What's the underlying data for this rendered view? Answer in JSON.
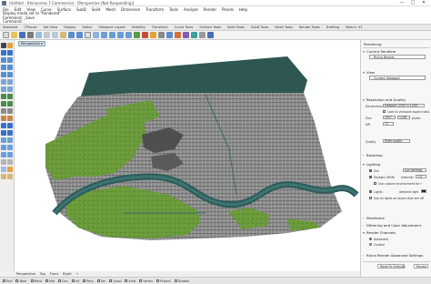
{
  "window": {
    "title": "Untitled - Rhinoceros 7 Commercial - [Perspective (Not Responding)]",
    "controls": [
      "—",
      "□",
      "✕"
    ]
  },
  "menu": [
    "File",
    "Edit",
    "View",
    "Curve",
    "Surface",
    "SubD",
    "Solid",
    "Mesh",
    "Dimension",
    "Transform",
    "Tools",
    "Analyze",
    "Render",
    "Panels",
    "Help"
  ],
  "command": {
    "lines": [
      "Display mode set to \"Rendered\"",
      "Command: _Save",
      "Command:"
    ]
  },
  "toolbar_tabs": [
    {
      "label": "Standard",
      "active": false
    },
    {
      "label": "CPlanes",
      "active": false
    },
    {
      "label": "Set View",
      "active": false
    },
    {
      "label": "Display",
      "active": false
    },
    {
      "label": "Select",
      "active": false
    },
    {
      "label": "Viewport Layout",
      "active": false
    },
    {
      "label": "Visibility",
      "active": false
    },
    {
      "label": "Transform",
      "active": false
    },
    {
      "label": "Curve Tools",
      "active": false
    },
    {
      "label": "Surface Tools",
      "active": false
    },
    {
      "label": "Solid Tools",
      "active": false
    },
    {
      "label": "SubD Tools",
      "active": false
    },
    {
      "label": "Mesh Tools",
      "active": false
    },
    {
      "label": "Render Tools",
      "active": false
    },
    {
      "label": "Drafting",
      "active": false
    },
    {
      "label": "New in V7",
      "active": false
    }
  ],
  "viewport": {
    "label": "Perspective",
    "label_arrow": "▾"
  },
  "view_tabs": [
    "Perspective",
    "Top",
    "Front",
    "Right",
    "+"
  ],
  "osnaps": [
    {
      "label": "End",
      "on": false
    },
    {
      "label": "Near",
      "on": false
    },
    {
      "label": "Point",
      "on": false
    },
    {
      "label": "Mid",
      "on": false
    },
    {
      "label": "Cen",
      "on": false
    },
    {
      "label": "Int",
      "on": false
    },
    {
      "label": "Perp",
      "on": false
    },
    {
      "label": "Tan",
      "on": false
    },
    {
      "label": "Quad",
      "on": false
    },
    {
      "label": "Knot",
      "on": false
    },
    {
      "label": "Vertex",
      "on": false
    },
    {
      "label": "Project",
      "on": false
    },
    {
      "label": "Disable",
      "on": false
    }
  ],
  "panel": {
    "title": "Rendering",
    "sections": {
      "current_renderer": "Current Renderer",
      "renderer_value": "Rhino Render",
      "view": "View",
      "view_value": "Current Viewport",
      "resolution": "Resolution and Quality",
      "dimensions_label": "Dimensions",
      "dimensions_value": "Viewport (2057 x 1158)",
      "lock_label": "Lock to viewport aspect ratio",
      "size_label": "Size",
      "width": "2057",
      "height": "1158",
      "units": "pixels",
      "dpi_label": "DPI",
      "dpi_value": "72",
      "quality_label": "Quality",
      "quality_value": "Draft quality",
      "backdrop": "Backdrop",
      "lighting": "Lighting",
      "sun": "Sun",
      "sun_value": "Sun settings",
      "skylight": "Skylight (HDR)",
      "intensity_label": "Intensity",
      "intensity_value": "1.0",
      "use_env": "Use custom environment for r",
      "lights": "Lights",
      "ambient": "Ambient light",
      "use_all": "Use all lights on layers that are off",
      "wireframe": "Wireframe",
      "dithering": "Dithering and Color Adjustment",
      "render_channels": "Render Channels",
      "automatic": "Automatic",
      "custom": "Custom",
      "advanced": "Rhino Render Advanced Settings",
      "reset_label": "Reset To Defaults",
      "render_label": "Render"
    }
  },
  "colors": {
    "ground_green": "#6a9a3a",
    "urban_gray": "#8a8a8a",
    "river_teal": "#2b5c5a",
    "water_dark": "#2e5752",
    "accent_blue": "#3a6fc4"
  }
}
